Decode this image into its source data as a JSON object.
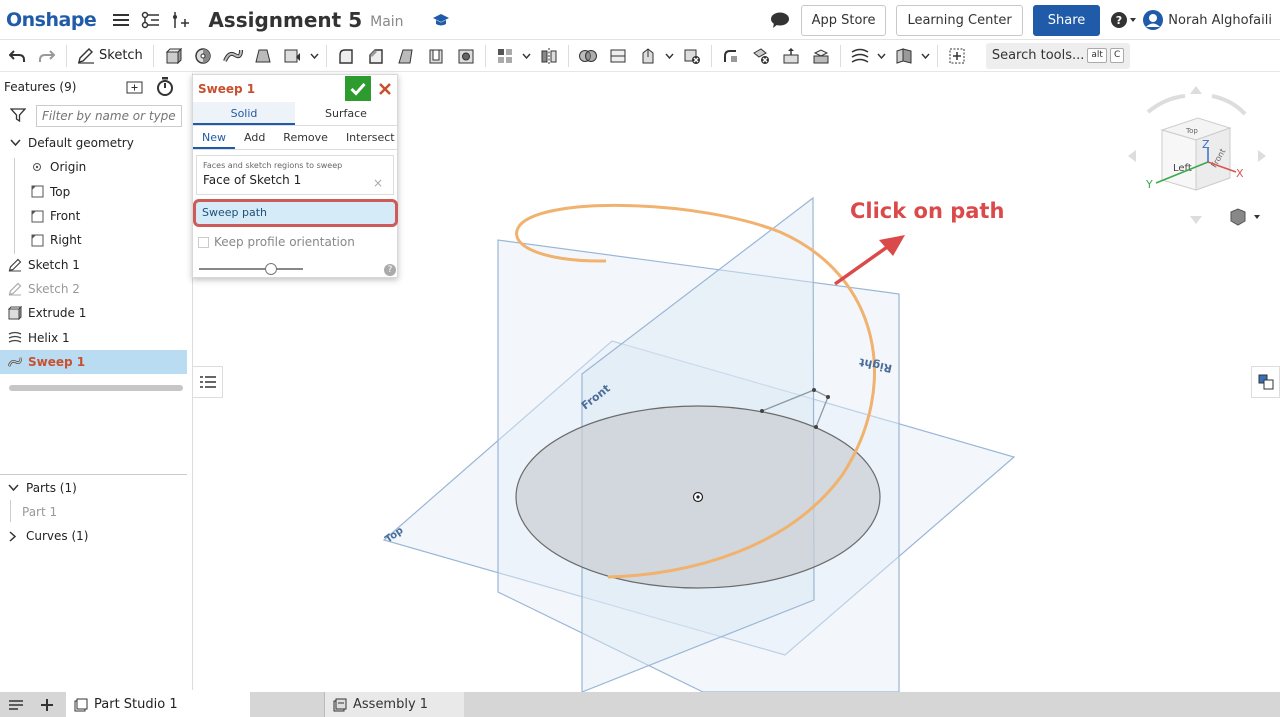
{
  "header": {
    "logo": "Onshape",
    "doc_title": "Assignment 5",
    "branch": "Main",
    "app_store": "App Store",
    "learning_center": "Learning Center",
    "share": "Share",
    "user_name": "Norah Alghofaili"
  },
  "toolbar": {
    "sketch_label": "Sketch",
    "search_label": "Search tools...",
    "shortcut_1": "alt",
    "shortcut_2": "C"
  },
  "feature_tree": {
    "title": "Features (9)",
    "filter_placeholder": "Filter by name or type",
    "default_geometry": "Default geometry",
    "origin": "Origin",
    "top": "Top",
    "front": "Front",
    "right": "Right",
    "items": [
      {
        "label": "Sketch 1",
        "icon": "sketch-icon",
        "state": "normal"
      },
      {
        "label": "Sketch 2",
        "icon": "sketch-icon",
        "state": "dim"
      },
      {
        "label": "Extrude 1",
        "icon": "extrude-icon",
        "state": "normal"
      },
      {
        "label": "Helix 1",
        "icon": "helix-icon",
        "state": "normal"
      },
      {
        "label": "Sweep 1",
        "icon": "sweep-icon",
        "state": "selected"
      }
    ],
    "parts": "Parts (1)",
    "part_1": "Part 1",
    "curves": "Curves (1)"
  },
  "sweep_dialog": {
    "title": "Sweep 1",
    "tab_solid": "Solid",
    "tab_surface": "Surface",
    "op_new": "New",
    "op_add": "Add",
    "op_remove": "Remove",
    "op_intersect": "Intersect",
    "field_caption": "Faces and sketch regions to sweep",
    "field_value": "Face of Sketch 1",
    "sweep_path": "Sweep path",
    "keep_orientation": "Keep profile orientation",
    "help": "?"
  },
  "viewport": {
    "annotation": "Click on path",
    "plane_front": "Front",
    "plane_top": "Top",
    "plane_right": "Right",
    "cube_top": "Top",
    "cube_left": "Left",
    "cube_front": "Front",
    "axis_x": "X",
    "axis_y": "Y",
    "axis_z": "Z"
  },
  "bottom_tabs": {
    "part_studio": "Part Studio 1",
    "assembly": "Assembly 1"
  },
  "colors": {
    "brand": "#1f5ba8",
    "accent_feature": "#c8502e",
    "helix": "#f0b26e",
    "annotation": "#db4a4a",
    "confirm": "#2d9b2d"
  }
}
